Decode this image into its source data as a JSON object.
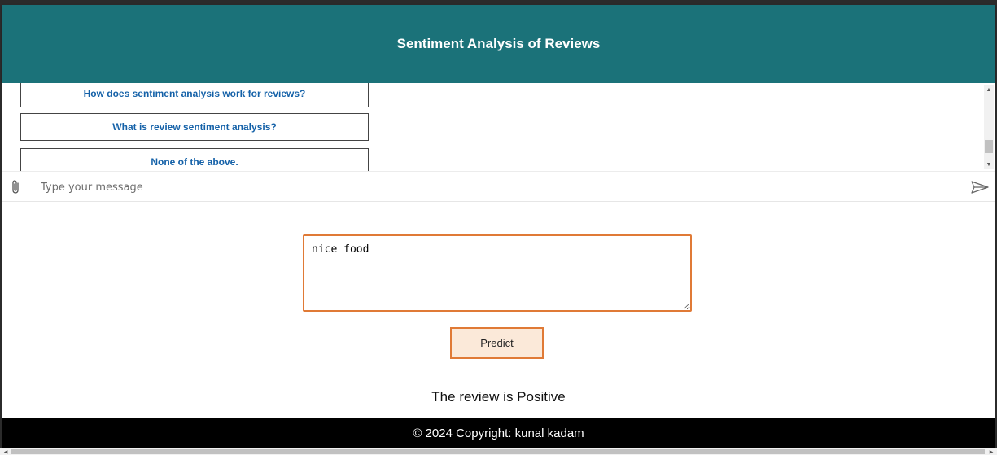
{
  "header": {
    "title": "Sentiment Analysis of Reviews",
    "background_color": "#1b7279"
  },
  "chat": {
    "suggestions": [
      "How does sentiment analysis work for reviews?",
      "What is review sentiment analysis?",
      "None of the above."
    ],
    "input_placeholder": "Type your message",
    "attach_icon": "paperclip-icon",
    "send_icon": "send-icon"
  },
  "form": {
    "review_value": "nice food",
    "predict_label": "Predict",
    "accent_color": "#e07a36"
  },
  "result": {
    "text": "The review is Positive"
  },
  "footer": {
    "text": "© 2024 Copyright: kunal kadam"
  }
}
